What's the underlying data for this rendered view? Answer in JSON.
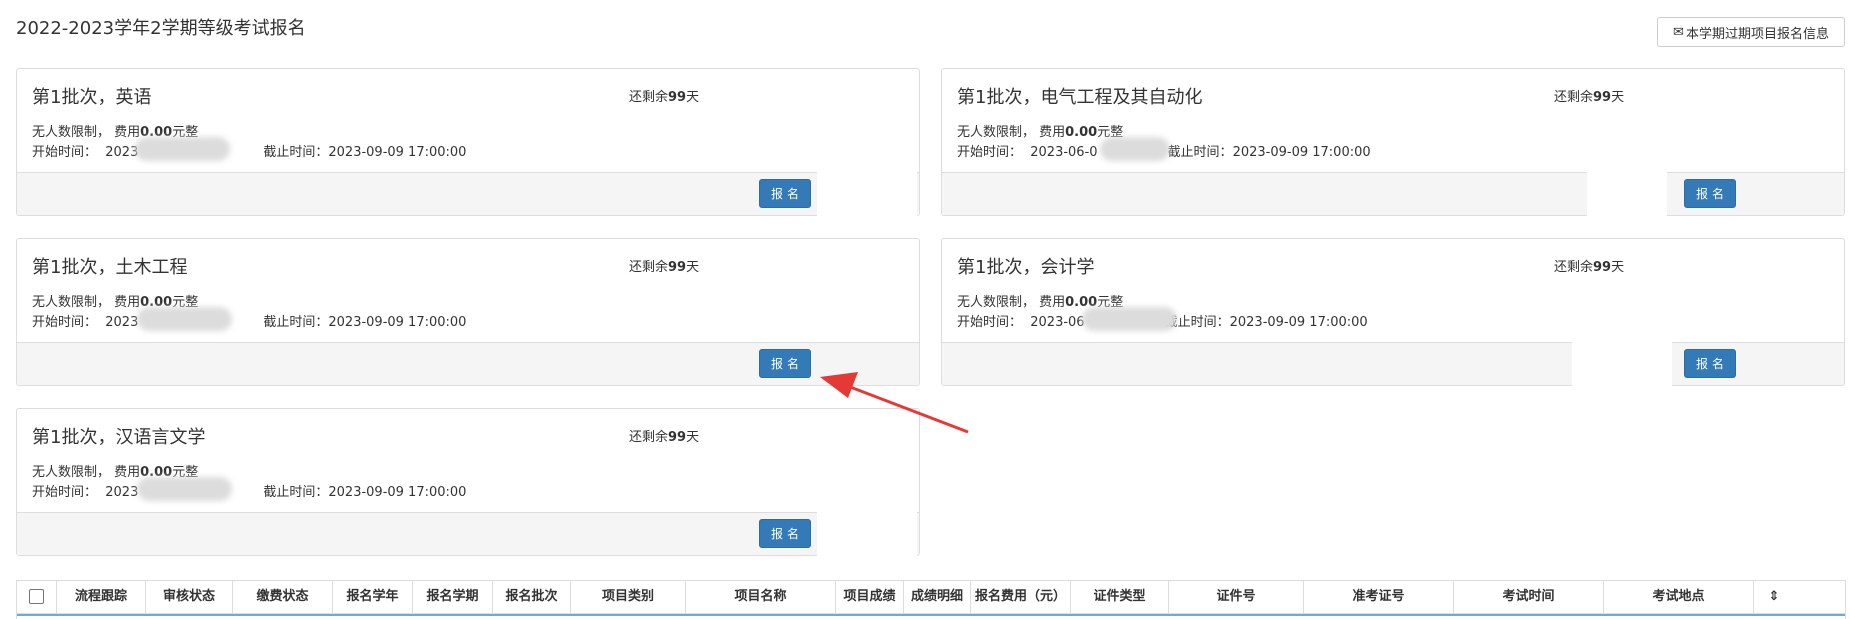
{
  "page": {
    "title": "2022-2023学年2学期等级考试报名",
    "past_button_label": "本学期过期项目报名信息",
    "past_button_icon": "envelope-icon"
  },
  "cards": [
    {
      "title": "第1批次，英语",
      "remain_prefix": "还剩余",
      "remain_days": "99",
      "remain_suffix": "天",
      "limit_prefix": "无人数限制，  费用",
      "fee": "0.00",
      "fee_suffix": "元整",
      "start_label": "开始时间：  ",
      "start_value": "2023",
      "end_label": "截止时间：",
      "end_value": "2023-09-09 17:00:00",
      "button_label": "报名"
    },
    {
      "title": "第1批次，电气工程及其自动化",
      "remain_prefix": "还剩余",
      "remain_days": "99",
      "remain_suffix": "天",
      "limit_prefix": "无人数限制，  费用",
      "fee": "0.00",
      "fee_suffix": "元整",
      "start_label": "开始时间：  ",
      "start_value": "2023-06-0",
      "end_label": "截止时间：",
      "end_value": "2023-09-09 17:00:00",
      "button_label": "报名"
    },
    {
      "title": "第1批次，土木工程",
      "remain_prefix": "还剩余",
      "remain_days": "99",
      "remain_suffix": "天",
      "limit_prefix": "无人数限制，  费用",
      "fee": "0.00",
      "fee_suffix": "元整",
      "start_label": "开始时间：  ",
      "start_value": "2023",
      "end_label": "截止时间：",
      "end_value": "2023-09-09 17:00:00",
      "button_label": "报名"
    },
    {
      "title": "第1批次，会计学",
      "remain_prefix": "还剩余",
      "remain_days": "99",
      "remain_suffix": "天",
      "limit_prefix": "无人数限制，  费用",
      "fee": "0.00",
      "fee_suffix": "元整",
      "start_label": "开始时间：  ",
      "start_value": "2023-06",
      "end_label": "截止时间：",
      "end_value": "2023-09-09 17:00:00",
      "button_label": "报名"
    },
    {
      "title": "第1批次，汉语言文学",
      "remain_prefix": "还剩余",
      "remain_days": "99",
      "remain_suffix": "天",
      "limit_prefix": "无人数限制，  费用",
      "fee": "0.00",
      "fee_suffix": "元整",
      "start_label": "开始时间：  ",
      "start_value": "2023",
      "end_label": "截止时间：",
      "end_value": "2023-09-09 17:00:00",
      "button_label": "报名"
    }
  ],
  "table": {
    "columns": [
      "流程跟踪",
      "审核状态",
      "缴费状态",
      "报名学年",
      "报名学期",
      "报名批次",
      "项目类别",
      "项目名称",
      "项目成绩",
      "成绩明细",
      "报名费用（元）",
      "证件类型",
      "证件号",
      "准考证号",
      "考试时间",
      "考试地点"
    ]
  },
  "colors": {
    "primary_button": "#337ab7",
    "annotation_arrow": "#e53935"
  }
}
